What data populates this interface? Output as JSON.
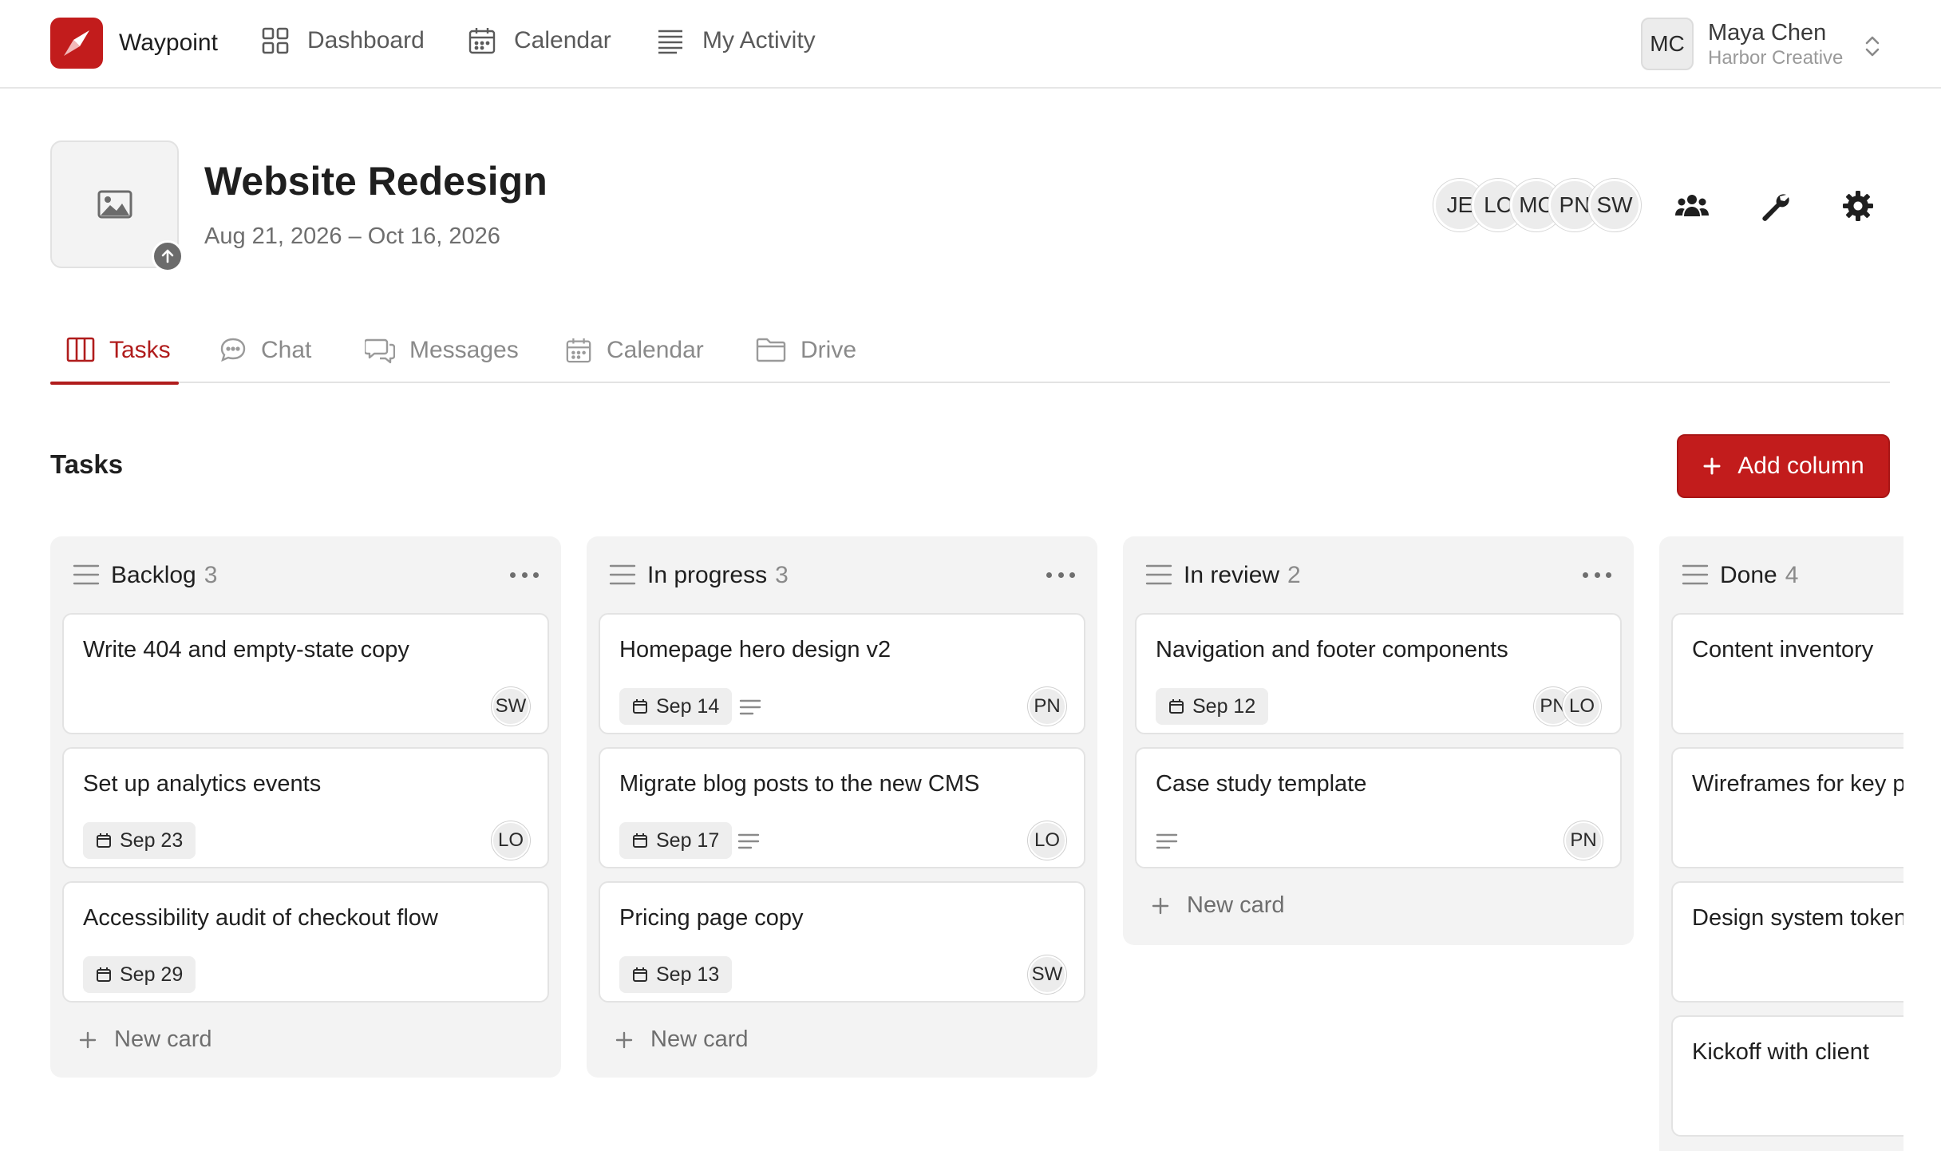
{
  "brand": {
    "name": "Waypoint",
    "accent": "#c21c1c"
  },
  "nav": {
    "dashboard": "Dashboard",
    "calendar": "Calendar",
    "activity": "My Activity"
  },
  "account": {
    "initials": "MC",
    "name": "Maya Chen",
    "org": "Harbor Creative"
  },
  "project": {
    "title": "Website Redesign",
    "dates": "Aug 21, 2026 – Oct 16, 2026",
    "members": [
      "JE",
      "LC",
      "MC",
      "PN",
      "SW"
    ]
  },
  "tabs": {
    "tasks": "Tasks",
    "chat": "Chat",
    "messages": "Messages",
    "calendar": "Calendar",
    "drive": "Drive"
  },
  "board": {
    "title": "Tasks",
    "add_column": "Add column",
    "new_card": "New card",
    "columns": [
      {
        "name": "Backlog",
        "count": "3",
        "cards": [
          {
            "title": "Write 404 and empty-state copy",
            "assignees": [
              "SW"
            ]
          },
          {
            "title": "Set up analytics events",
            "date": "Sep 23",
            "assignees": [
              "LO"
            ]
          },
          {
            "title": "Accessibility audit of checkout flow",
            "date": "Sep 29",
            "assignees": []
          }
        ]
      },
      {
        "name": "In progress",
        "count": "3",
        "cards": [
          {
            "title": "Homepage hero design v2",
            "date": "Sep 14",
            "has_description": true,
            "assignees": [
              "PN"
            ]
          },
          {
            "title": "Migrate blog posts to the new CMS",
            "date": "Sep 17",
            "has_description": true,
            "assignees": [
              "LO"
            ]
          },
          {
            "title": "Pricing page copy",
            "date": "Sep 13",
            "assignees": [
              "SW"
            ]
          }
        ]
      },
      {
        "name": "In review",
        "count": "2",
        "cards": [
          {
            "title": "Navigation and footer components",
            "date": "Sep 12",
            "assignees": [
              "PN",
              "LO"
            ]
          },
          {
            "title": "Case study template",
            "has_description": true,
            "assignees": [
              "PN"
            ]
          }
        ]
      },
      {
        "name": "Done",
        "count": "4",
        "cards": [
          {
            "title": "Content inventory"
          },
          {
            "title": "Wireframes for key pages"
          },
          {
            "title": "Design system tokens"
          },
          {
            "title": "Kickoff with client"
          }
        ]
      }
    ]
  }
}
